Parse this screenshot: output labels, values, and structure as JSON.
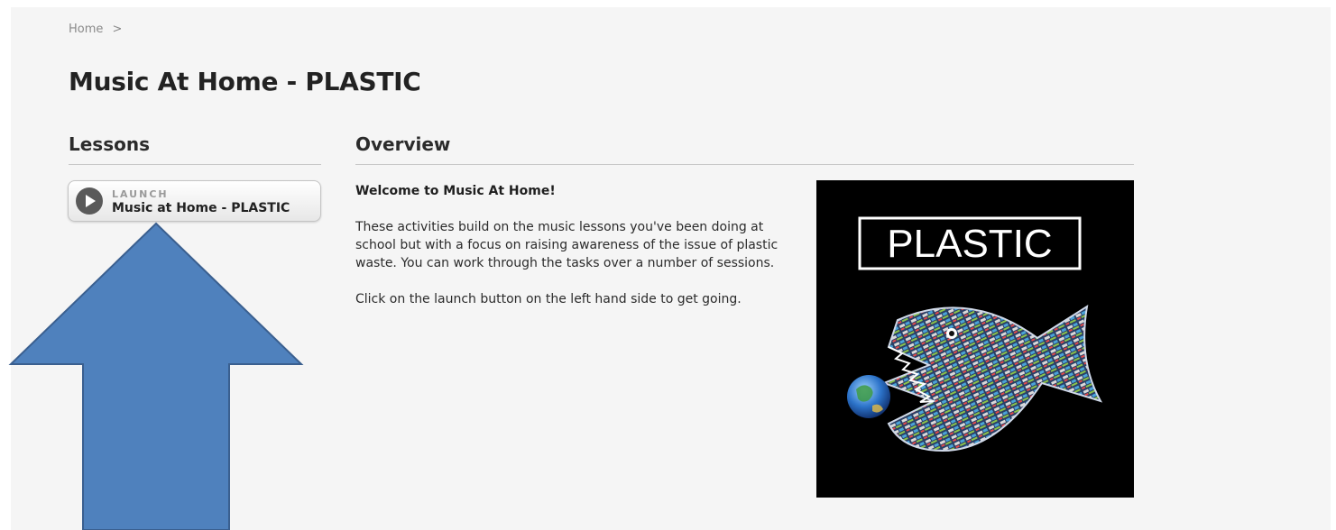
{
  "breadcrumb": {
    "home_label": "Home",
    "separator": ">"
  },
  "page": {
    "title": "Music At Home - PLASTIC"
  },
  "lessons": {
    "heading": "Lessons",
    "launch_button": {
      "small_label": "LAUNCH",
      "name": "Music at Home - PLASTIC"
    }
  },
  "overview": {
    "heading": "Overview",
    "welcome": "Welcome to Music At Home!",
    "paragraph_1": "These activities build on the music lessons you've been doing at school but with a focus on raising awareness of the issue of plastic waste. You can work through the tasks over a number of sessions.",
    "paragraph_2": "Click on the launch button on the left hand side to get going.",
    "poster": {
      "title": "PLASTIC",
      "subject_icon": "plastic-fish-eating-earth-image"
    }
  },
  "annotation": {
    "icon": "up-arrow-icon",
    "fill_color": "#4f81bd",
    "stroke_color": "#3a5f8f"
  },
  "colors": {
    "page_background": "#f5f5f5",
    "text_primary": "#222222",
    "text_muted": "#8a8a8a"
  }
}
